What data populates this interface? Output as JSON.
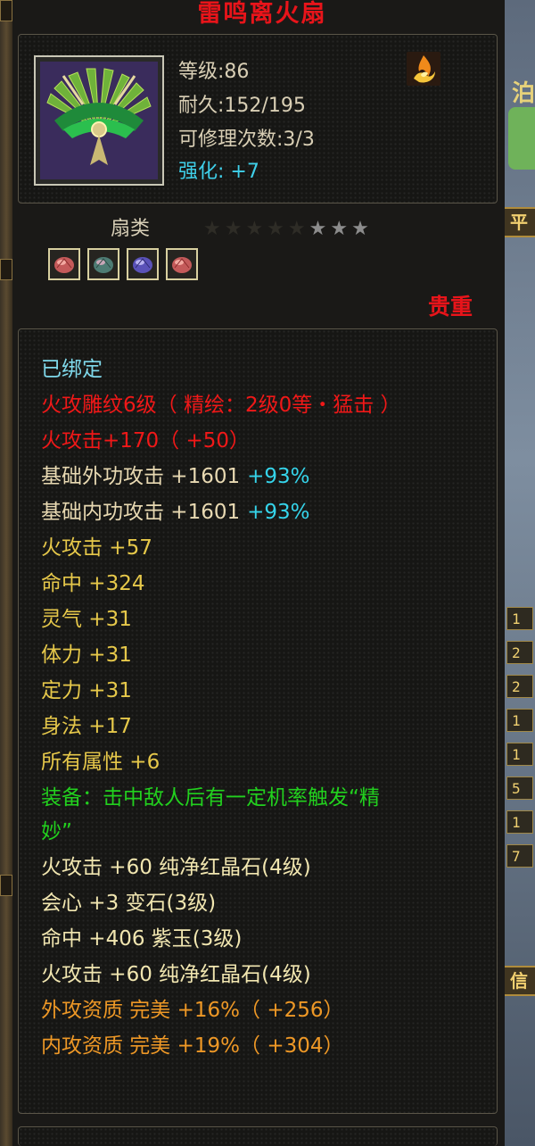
{
  "item": {
    "name": "雷鸣离火扇",
    "level_label": "等级",
    "level_value": ":86",
    "durability_label": "耐久",
    "durability_value": ":152/195",
    "repair_label": "可修理次数",
    "repair_value": ":3/3",
    "enhance_label": "强化:",
    "enhance_value": "+7",
    "category": "扇类",
    "stars_dim": "★★★★★",
    "stars_lit": "★★★",
    "rarity": "贵重",
    "icon": "green-fan-icon",
    "element_badge_icon": "fire-element-icon"
  },
  "gems": [
    {
      "icon": "red-crystal-gem-icon",
      "color": "#d06a6a"
    },
    {
      "icon": "green-stone-gem-icon",
      "color": "#5a8a80"
    },
    {
      "icon": "purple-jade-gem-icon",
      "color": "#6a64c8"
    },
    {
      "icon": "red-crystal-gem-icon",
      "color": "#d06a6a"
    }
  ],
  "stats": {
    "bound": "已绑定",
    "carving": "火攻雕纹6级（ 精绘：2级0等・猛击 ）",
    "fire_attack": "火攻击+170（ +50）",
    "ext_attack": "基础外功攻击 +1601",
    "ext_attack_pct": "+93%",
    "int_attack": "基础内功攻击 +1601",
    "int_attack_pct": "+93%",
    "attrs": [
      "火攻击 +57",
      "命中 +324",
      "灵气 +31",
      "体力 +31",
      "定力 +31",
      "身法 +17",
      "所有属性 +6"
    ],
    "equip_effect_1": "装备：击中敌人后有一定机率触发“精",
    "equip_effect_2": "妙”",
    "gem_lines": [
      "火攻击 +60 纯净红晶石(4级)",
      "会心 +3 变石(3级)",
      "命中 +406 紫玉(3级)",
      "火攻击 +60 纯净红晶石(4级)"
    ],
    "ext_quality": "外攻资质 完美 +16%（ +256）",
    "int_quality": "内攻资质 完美 +19%（ +304）"
  },
  "background": {
    "right_glyph": "泊",
    "right_banner_top": "平",
    "right_banner_bottom": "信",
    "right_tabs": [
      "1",
      "2",
      "2",
      "1",
      "1",
      "5",
      "1",
      "7"
    ]
  },
  "colors": {
    "title": "#e8141a",
    "enhance": "#3fd0ea",
    "rare": "#e8141a",
    "equip_effect": "#22d01e",
    "quality": "#ee9826"
  }
}
